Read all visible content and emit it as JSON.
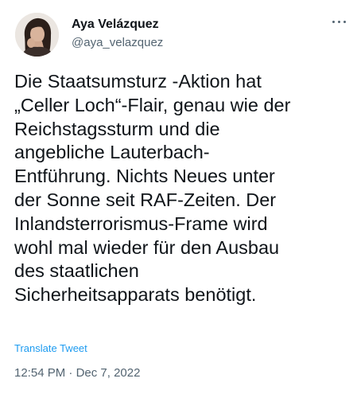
{
  "author": {
    "display_name": "Aya Velázquez",
    "handle": "@aya_velazquez",
    "avatar_icon": "profile-photo"
  },
  "menu": {
    "more_icon": "more-horizontal-icon"
  },
  "tweet": {
    "lines": [
      "Die Staatsumsturz -Aktion hat",
      "„Celler Loch“-Flair, genau wie der",
      "Reichstagssturm und die",
      "angebliche Lauterbach-",
      "Entführung. Nichts Neues unter",
      "der Sonne seit RAF-Zeiten. Der",
      "Inlandsterrorismus-Frame wird",
      "wohl mal wieder für den Ausbau",
      "des staatlichen",
      "Sicherheitsapparats benötigt."
    ],
    "translate_label": "Translate Tweet",
    "time": "12:54 PM",
    "separator": "·",
    "date": "Dec 7, 2022"
  },
  "colors": {
    "text": "#0f1419",
    "secondary": "#536471",
    "link": "#1d9bf0"
  }
}
